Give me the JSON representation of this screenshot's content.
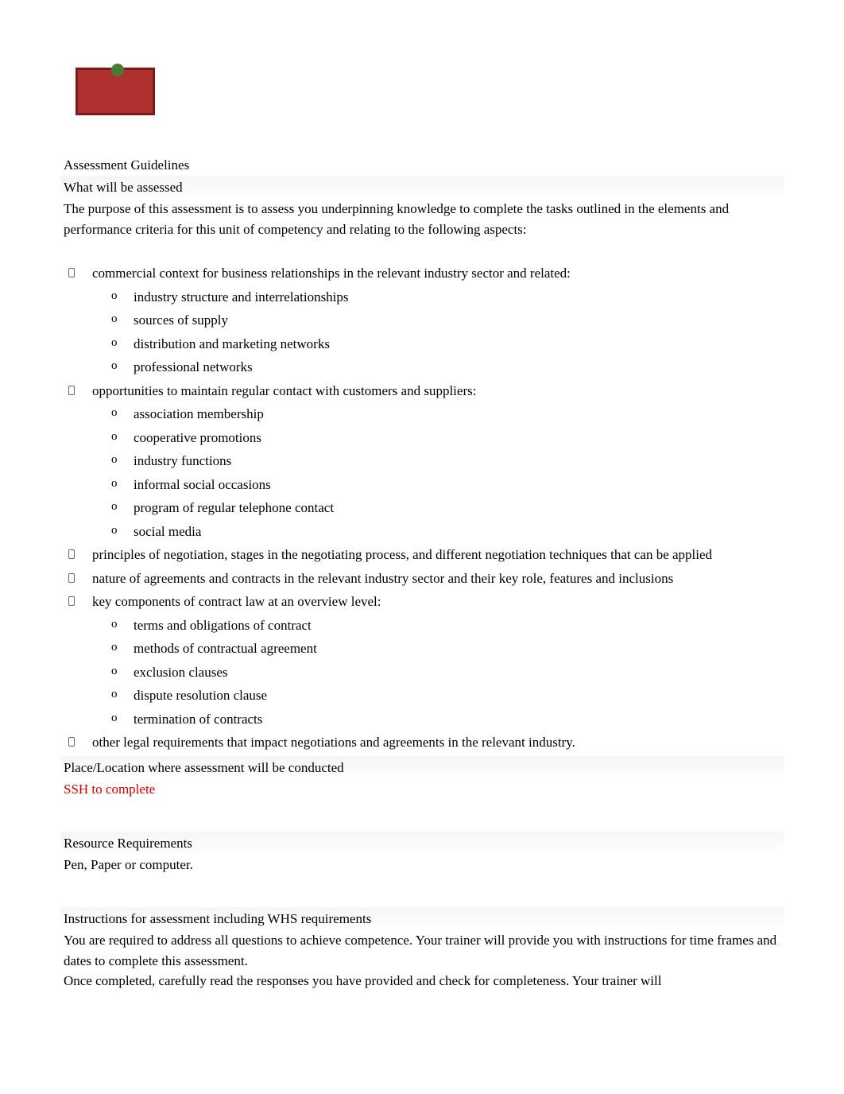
{
  "logo": {
    "subtext": ""
  },
  "heading_main": "Assessment Guidelines",
  "heading_what": "What will be assessed",
  "intro": "The purpose of this assessment is to assess you underpinning knowledge to complete the tasks outlined in the elements and performance criteria for this unit of competency and relating to the following aspects:",
  "bullets": {
    "b1": "commercial context for business relationships in the relevant industry sector and related:",
    "b1_sub": {
      "s1": "industry structure and interrelationships",
      "s2": "sources of supply",
      "s3": "distribution and marketing networks",
      "s4": "professional networks"
    },
    "b2": "opportunities to maintain regular contact with customers and suppliers:",
    "b2_sub": {
      "s1": "association membership",
      "s2": "cooperative promotions",
      "s3": "industry functions",
      "s4": "informal social occasions",
      "s5": "program of regular telephone contact",
      "s6": "social media"
    },
    "b3": "principles of negotiation, stages in the negotiating process, and different negotiation techniques that can be applied",
    "b4": "nature of agreements and contracts in the relevant industry sector and their key role, features and inclusions",
    "b5": "key components of contract law at an overview level:",
    "b5_sub": {
      "s1": "terms and obligations of contract",
      "s2": "methods of contractual agreement",
      "s3": "exclusion clauses",
      "s4": "dispute resolution clause",
      "s5": "termination of contracts"
    },
    "b6": "other legal requirements that impact negotiations and agreements in the relevant industry."
  },
  "heading_place": "Place/Location where assessment will be conducted",
  "ssh_text": "SSH to complete",
  "heading_resource": "Resource Requirements",
  "resource_text": "Pen, Paper or computer.",
  "heading_instructions": "Instructions for assessment including WHS requirements",
  "instructions_p1": "You are required to address all questions to achieve competence. Your trainer will provide you with instructions for time frames and dates to complete this assessment.",
  "instructions_p2": "Once completed, carefully read the responses you have provided and check for completeness. Your trainer will"
}
